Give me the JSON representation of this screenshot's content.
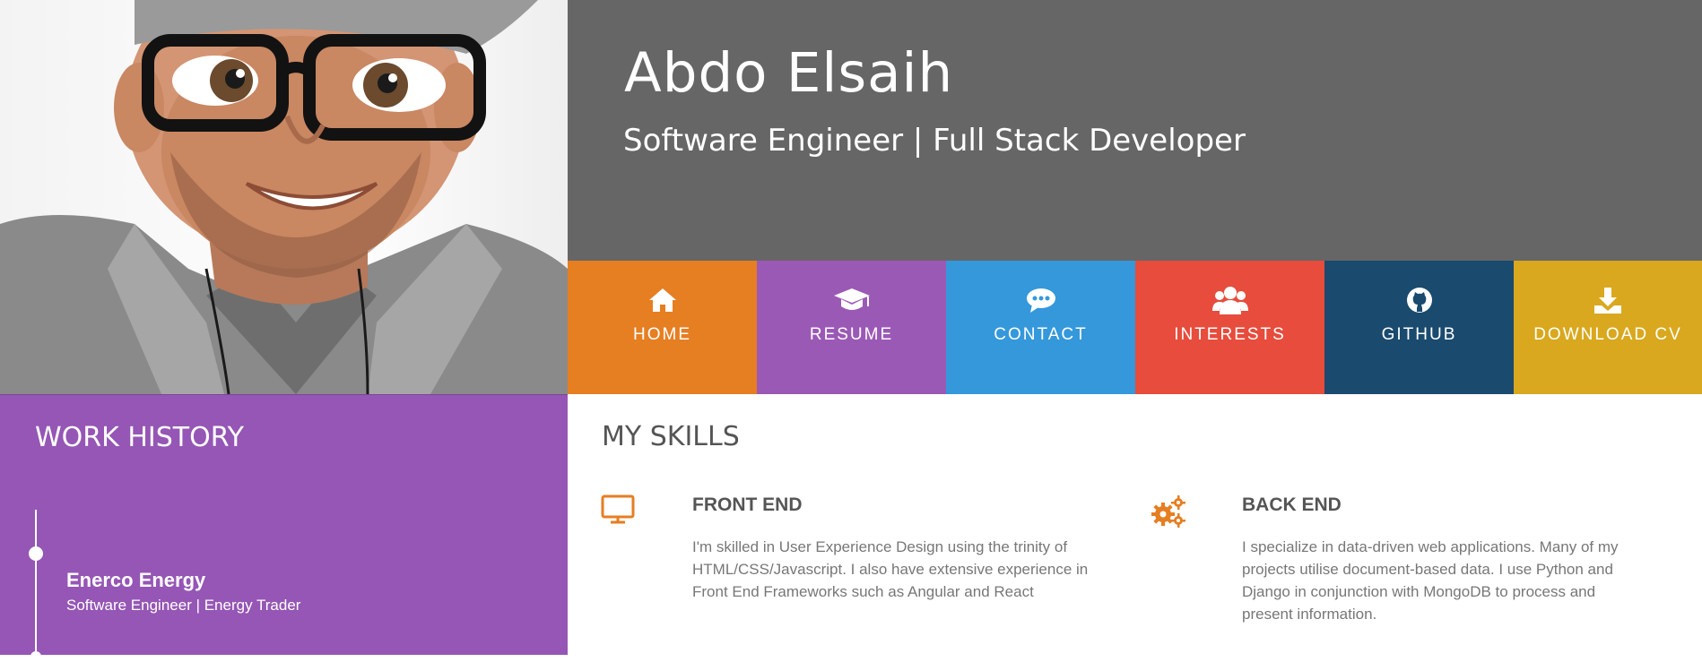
{
  "header": {
    "name": "Abdo Elsaih",
    "subtitle": "Software Engineer | Full Stack Developer"
  },
  "nav": [
    {
      "label": "HOME",
      "icon": "home-icon",
      "color": "#e67e22"
    },
    {
      "label": "RESUME",
      "icon": "graduation-cap-icon",
      "color": "#9b59b6"
    },
    {
      "label": "CONTACT",
      "icon": "chat-bubble-icon",
      "color": "#3498db"
    },
    {
      "label": "INTERESTS",
      "icon": "users-icon",
      "color": "#e74c3c"
    },
    {
      "label": "GITHUB",
      "icon": "github-icon",
      "color": "#1a4a6e"
    },
    {
      "label": "DOWNLOAD CV",
      "icon": "download-icon",
      "color": "#d9a81e"
    }
  ],
  "work_history": {
    "title": "WORK HISTORY",
    "jobs": [
      {
        "company": "Enerco Energy",
        "role": "Software Engineer | Energy Trader"
      }
    ]
  },
  "skills": {
    "title": "MY SKILLS",
    "accent": "#e67e22",
    "items": [
      {
        "icon": "monitor-icon",
        "title": "FRONT END",
        "text": "I'm skilled in User Experience Design using the trinity of HTML/CSS/Javascript. I also have extensive experience in Front End Frameworks such as Angular and React"
      },
      {
        "icon": "gears-icon",
        "title": "BACK END",
        "text": "I specialize in data-driven web applications. Many of my projects utilise document-based data. I use Python and Django in conjunction with MongoDB to process and present information."
      }
    ]
  }
}
